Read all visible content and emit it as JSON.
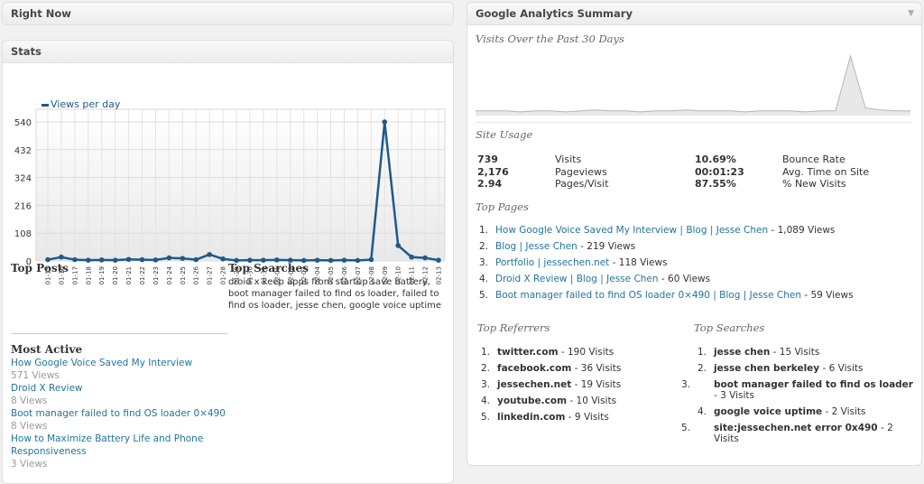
{
  "right_now": {
    "title": "Right Now"
  },
  "stats": {
    "title": "Stats",
    "legend": "Views per day",
    "top_posts_title": "Top Posts",
    "top_searches_title": "Top Searches",
    "top_searches_text": "droid x keep apps from startup save battery, boot manager failed to find os loader,  failed to find os loader,  jesse chen,  google voice uptime",
    "most_active_title": "Most Active",
    "most_active": [
      {
        "title": "How Google Voice Saved My Interview",
        "views": "571 Views"
      },
      {
        "title": "Droid X Review",
        "views": "8 Views"
      },
      {
        "title": "Boot manager failed to find OS loader 0×490",
        "views": "8 Views"
      },
      {
        "title": "How to Maximize Battery Life and Phone Responsiveness",
        "views": "3 Views"
      }
    ]
  },
  "chart_data": {
    "type": "line",
    "x": [
      "01-15",
      "01-16",
      "01-17",
      "01-18",
      "01-19",
      "01-20",
      "01-21",
      "01-22",
      "01-23",
      "01-24",
      "01-25",
      "01-26",
      "01-27",
      "01-28",
      "01-29",
      "01-30",
      "01-31",
      "02-01",
      "02-02",
      "02-03",
      "02-04",
      "02-05",
      "02-06",
      "02-07",
      "02-08",
      "02-09",
      "02-10",
      "02-11",
      "02-12",
      "02-13"
    ],
    "series": [
      {
        "name": "Views per day",
        "values": [
          5,
          15,
          5,
          3,
          4,
          3,
          6,
          5,
          4,
          12,
          10,
          5,
          25,
          8,
          2,
          3,
          3,
          4,
          3,
          2,
          3,
          2,
          3,
          2,
          5,
          540,
          60,
          15,
          12,
          3
        ]
      }
    ],
    "yticks": [
      0,
      108,
      216,
      324,
      432,
      540
    ],
    "ylim": [
      0,
      540
    ],
    "grid": true,
    "legend_position": "top-left",
    "color": "#1d5a8a"
  },
  "ga": {
    "title": "Google Analytics Summary",
    "visits_title": "Visits Over the Past 30 Days",
    "site_usage_title": "Site Usage",
    "usage": [
      {
        "v1": "739",
        "l1": "Visits",
        "v2": "10.69%",
        "l2": "Bounce Rate"
      },
      {
        "v1": "2,176",
        "l1": "Pageviews",
        "v2": "00:01:23",
        "l2": "Avg. Time on Site"
      },
      {
        "v1": "2.94",
        "l1": "Pages/Visit",
        "v2": "87.55%",
        "l2": "% New Visits"
      }
    ],
    "top_pages_title": "Top Pages",
    "top_pages": [
      {
        "n": "1.",
        "link": "How Google Voice Saved My Interview | Blog | Jesse Chen",
        "suffix": " - 1,089 Views"
      },
      {
        "n": "2.",
        "link": "Blog | Jesse Chen",
        "suffix": " - 219 Views"
      },
      {
        "n": "3.",
        "link": "Portfolio | jessechen.net",
        "suffix": " - 118 Views"
      },
      {
        "n": "4.",
        "link": "Droid X Review | Blog | Jesse Chen",
        "suffix": " - 60 Views"
      },
      {
        "n": "5.",
        "link": "Boot manager failed to find OS loader 0×490 | Blog | Jesse Chen",
        "suffix": " - 59 Views"
      }
    ],
    "top_referrers_title": "Top Referrers",
    "top_referrers": [
      {
        "n": "1.",
        "name": "twitter.com",
        "suffix": " - 190 Visits"
      },
      {
        "n": "2.",
        "name": "facebook.com",
        "suffix": " - 36 Visits"
      },
      {
        "n": "3.",
        "name": "jessechen.net",
        "suffix": " - 19 Visits"
      },
      {
        "n": "4.",
        "name": "youtube.com",
        "suffix": " - 10 Visits"
      },
      {
        "n": "5.",
        "name": "linkedin.com",
        "suffix": " - 9 Visits"
      }
    ],
    "top_searches_title": "Top Searches",
    "top_searches": [
      {
        "n": "1.",
        "name": "jesse chen",
        "suffix": " - 15 Visits"
      },
      {
        "n": "2.",
        "name": "jesse chen berkeley",
        "suffix": " - 6 Visits"
      },
      {
        "n": "3.",
        "name": "boot manager failed to find os loader",
        "suffix": " - 3 Visits"
      },
      {
        "n": "4.",
        "name": "google voice uptime",
        "suffix": " - 2 Visits"
      },
      {
        "n": "5.",
        "name": "site:jessechen.net error 0x490",
        "suffix": " - 2 Visits"
      }
    ],
    "sparkline": [
      3,
      3,
      3,
      2,
      3,
      3,
      2,
      3,
      4,
      3,
      3,
      2,
      3,
      3,
      4,
      3,
      3,
      3,
      2,
      3,
      3,
      3,
      2,
      3,
      3,
      60,
      6,
      4,
      3,
      3
    ]
  }
}
